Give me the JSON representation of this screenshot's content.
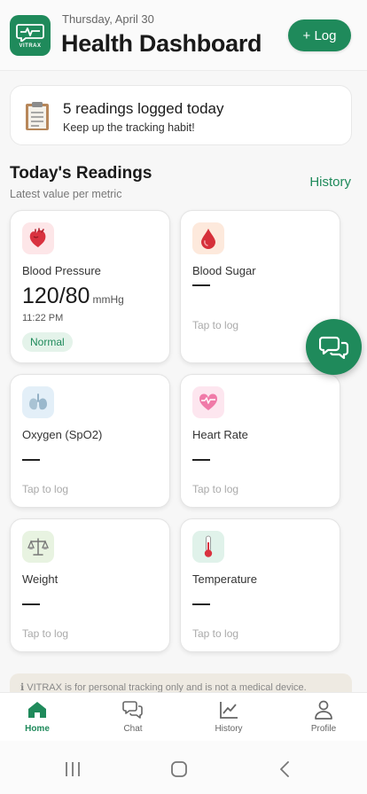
{
  "header": {
    "logo_text": "VITRAX",
    "date": "Thursday, April 30",
    "title": "Health Dashboard",
    "log_button": "+ Log"
  },
  "summary": {
    "icon": "clipboard-icon",
    "title": "5 readings logged today",
    "subtitle": "Keep up the tracking habit!"
  },
  "readings_section": {
    "title": "Today's Readings",
    "subtitle": "Latest value per metric",
    "history_link": "History"
  },
  "cards": [
    {
      "label": "Blood Pressure",
      "icon": "heart-organ-icon",
      "value": "120/80",
      "unit": "mmHg",
      "time": "11:22 PM",
      "status": "Normal"
    },
    {
      "label": "Blood Sugar",
      "icon": "blood-drop-icon",
      "hint": "Tap to log"
    },
    {
      "label": "Oxygen (SpO2)",
      "icon": "lungs-icon",
      "hint": "Tap to log"
    },
    {
      "label": "Heart Rate",
      "icon": "heart-pulse-icon",
      "hint": "Tap to log"
    },
    {
      "label": "Weight",
      "icon": "scale-icon",
      "hint": "Tap to log"
    },
    {
      "label": "Temperature",
      "icon": "thermometer-icon",
      "hint": "Tap to log"
    }
  ],
  "disclaimer": "ℹ VITRAX is for personal tracking only and is not a medical device.",
  "bottom_nav": [
    {
      "label": "Home",
      "icon": "home-icon",
      "active": true
    },
    {
      "label": "Chat",
      "icon": "chat-icon"
    },
    {
      "label": "History",
      "icon": "history-chart-icon"
    },
    {
      "label": "Profile",
      "icon": "profile-icon"
    }
  ],
  "colors": {
    "accent": "#1f8a5b",
    "badge_bg": "#e4f3ea",
    "background": "#f7f7f7"
  }
}
